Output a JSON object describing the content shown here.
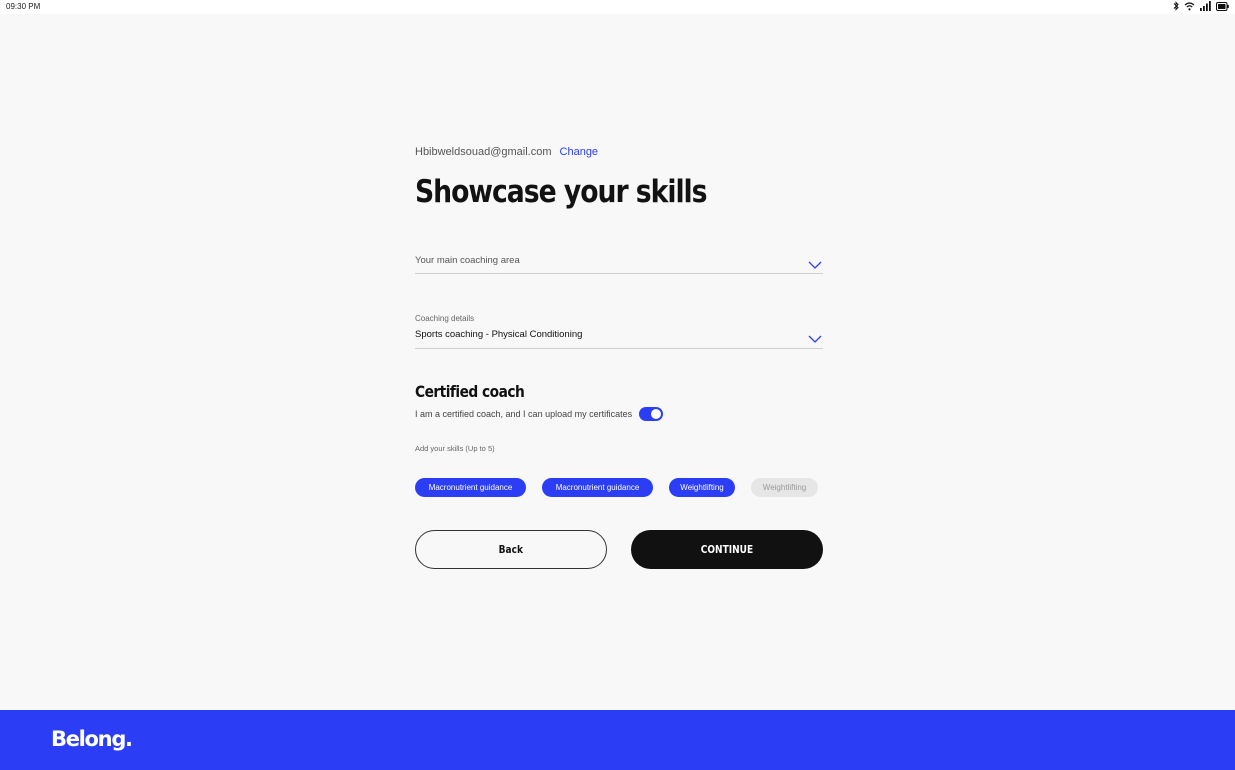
{
  "status_bar": {
    "time": "09:30 PM",
    "icons": [
      "bluetooth-icon",
      "wifi-icon",
      "signal-icon",
      "battery-icon"
    ]
  },
  "header": {
    "email": "Hbibweldsouad@gmail.com",
    "change_label": "Change"
  },
  "title": "Showcase your skills",
  "coaching_area": {
    "placeholder": "Your main coaching area"
  },
  "coaching_details": {
    "label": "Coaching details",
    "value": "Sports coaching - Physical Conditioning"
  },
  "certified": {
    "title": "Certified coach",
    "text": "I am a certified coach, and I can upload my certificates",
    "toggle_on": true
  },
  "skills": {
    "label": "Add your skills (Up to 5)",
    "chips": [
      {
        "label": "Macronutrient guidance",
        "selected": true
      },
      {
        "label": "Macronutrient guidance",
        "selected": true
      },
      {
        "label": "Weightlifting",
        "selected": true
      },
      {
        "label": "Weightlifting",
        "selected": false
      }
    ]
  },
  "buttons": {
    "back": "Back",
    "continue": "CONTINUE"
  },
  "footer": {
    "logo": "Belong."
  },
  "colors": {
    "accent": "#2b3ef5",
    "dark": "#111111",
    "background": "#f8f8f8",
    "chip_inactive": "#e6e6e6"
  }
}
